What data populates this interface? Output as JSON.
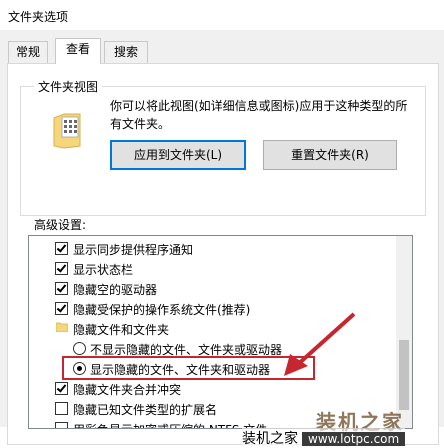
{
  "window": {
    "title": "文件夹选项"
  },
  "tabs": [
    {
      "label": "常规"
    },
    {
      "label": "查看"
    },
    {
      "label": "搜索"
    }
  ],
  "folder_views": {
    "group_label": "文件夹视图",
    "description": "你可以将此视图(如详细信息或图标)应用于这种类型的所有文件夹。",
    "apply_button": "应用到文件夹(L)",
    "reset_button": "重置文件夹(R)"
  },
  "advanced": {
    "label": "高级设置:",
    "items": [
      {
        "type": "checkbox",
        "checked": true,
        "label": "显示同步提供程序通知"
      },
      {
        "type": "checkbox",
        "checked": true,
        "label": "显示状态栏"
      },
      {
        "type": "checkbox",
        "checked": true,
        "label": "隐藏空的驱动器"
      },
      {
        "type": "checkbox",
        "checked": true,
        "label": "隐藏受保护的操作系统文件(推荐)"
      },
      {
        "type": "folder",
        "label": "隐藏文件和文件夹"
      },
      {
        "type": "radio",
        "checked": false,
        "label": "不显示隐藏的文件、文件夹或驱动器"
      },
      {
        "type": "radio",
        "checked": true,
        "label": "显示隐藏的文件、文件夹和驱动器"
      },
      {
        "type": "checkbox",
        "checked": true,
        "label": "隐藏文件夹合并冲突"
      },
      {
        "type": "checkbox",
        "checked": false,
        "label": "隐藏已知文件类型的扩展名"
      },
      {
        "type": "checkbox",
        "checked": false,
        "label": "用彩色显示加密或压缩的 NTFS 文件"
      }
    ]
  },
  "watermark": {
    "brand": "装机之家",
    "brand_small": "装机之家",
    "url": "www.lotpc.com"
  },
  "colors": {
    "highlight": "#c6262e",
    "accent": "#0078d7"
  }
}
